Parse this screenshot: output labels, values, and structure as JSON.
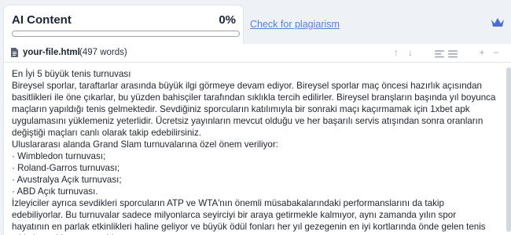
{
  "ai_card": {
    "title": "AI Content",
    "percent": "0%",
    "progress": 0
  },
  "plagiarism_tab": {
    "label": "Check for plagiarism"
  },
  "toolbar": {
    "file_name": "your-file.html",
    "word_count": "(497 words)"
  },
  "content": {
    "lines": [
      "En İyi 5 büyük tenis turnuvası",
      "Bireysel sporlar, taraftarlar arasında büyük ilgi görmeye devam ediyor. Bireysel sporlar maç öncesi hazırlık açısından basitlikleri ile öne çıkarlar, bu yüzden bahisçiler tarafından sıklıkla tercih edilirler. Bireysel branşların başında yıl boyunca maçların yapıldığı tenis gelmektedir. Sevdiğiniz sporcuların katılımıyla bir sonraki maçı kaçırmamak için 1xbet apk uygulamasını yüklemeniz yeterlidir. Ücretsiz yayınların mevcut olduğu ve her başarılı servis atışından sonra oranların değiştiği maçları canlı olarak takip edebilirsiniz.",
      "Uluslararası alanda Grand Slam turnuvalarına özel önem veriliyor:",
      "· Wimbledon turnuvası;",
      "· Roland-Garros turnuvası;",
      "· Avustralya Açık turnuvası;",
      "· ABD Açık turnuvası.",
      "İzleyiciler ayrıca sevdikleri sporcuların ATP ve WTA'nın önemli müsabakalarındaki performanslarını da takip edebiliyorlar. Bu turnuvalar sadece milyonlarca seyirciyi bir araya getirmekle kalmıyor, aynı zamanda yılın spor hayatının en parlak etkinlikleri haline geliyor ve büyük ödül fonları her yıl gezegenin en iyi kortlarında önde gelen tenis yıldızlarını bir araya getiriyor."
    ]
  },
  "colors": {
    "accent": "#4a6fd1",
    "link": "#5b7fd6"
  }
}
